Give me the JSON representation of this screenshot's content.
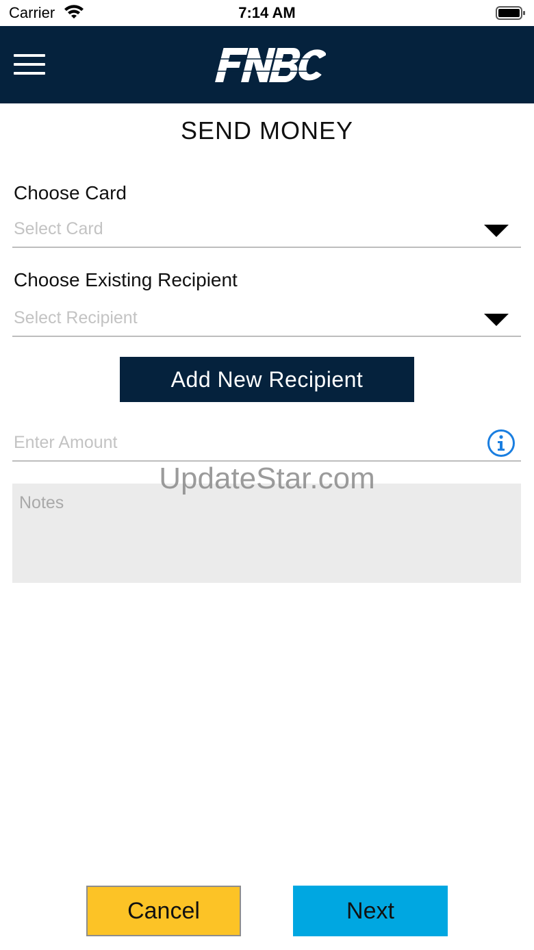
{
  "status_bar": {
    "carrier": "Carrier",
    "time": "7:14 AM"
  },
  "header": {
    "logo_text": "FNBC",
    "menu_icon": "hamburger-menu-icon",
    "background_color": "#05223d"
  },
  "page": {
    "title": "SEND MONEY"
  },
  "form": {
    "card": {
      "label": "Choose Card",
      "placeholder": "Select Card"
    },
    "recipient": {
      "label": "Choose Existing Recipient",
      "placeholder": "Select Recipient"
    },
    "add_recipient_label": "Add New Recipient",
    "amount": {
      "placeholder": "Enter Amount",
      "icon": "info-icon"
    },
    "notes": {
      "placeholder": "Notes"
    }
  },
  "watermark": "UpdateStar.com",
  "footer": {
    "cancel_label": "Cancel",
    "next_label": "Next"
  },
  "colors": {
    "navy": "#05223d",
    "cancel_yellow": "#fcc326",
    "next_blue": "#00a7e1",
    "info_blue": "#1a7ee0"
  }
}
